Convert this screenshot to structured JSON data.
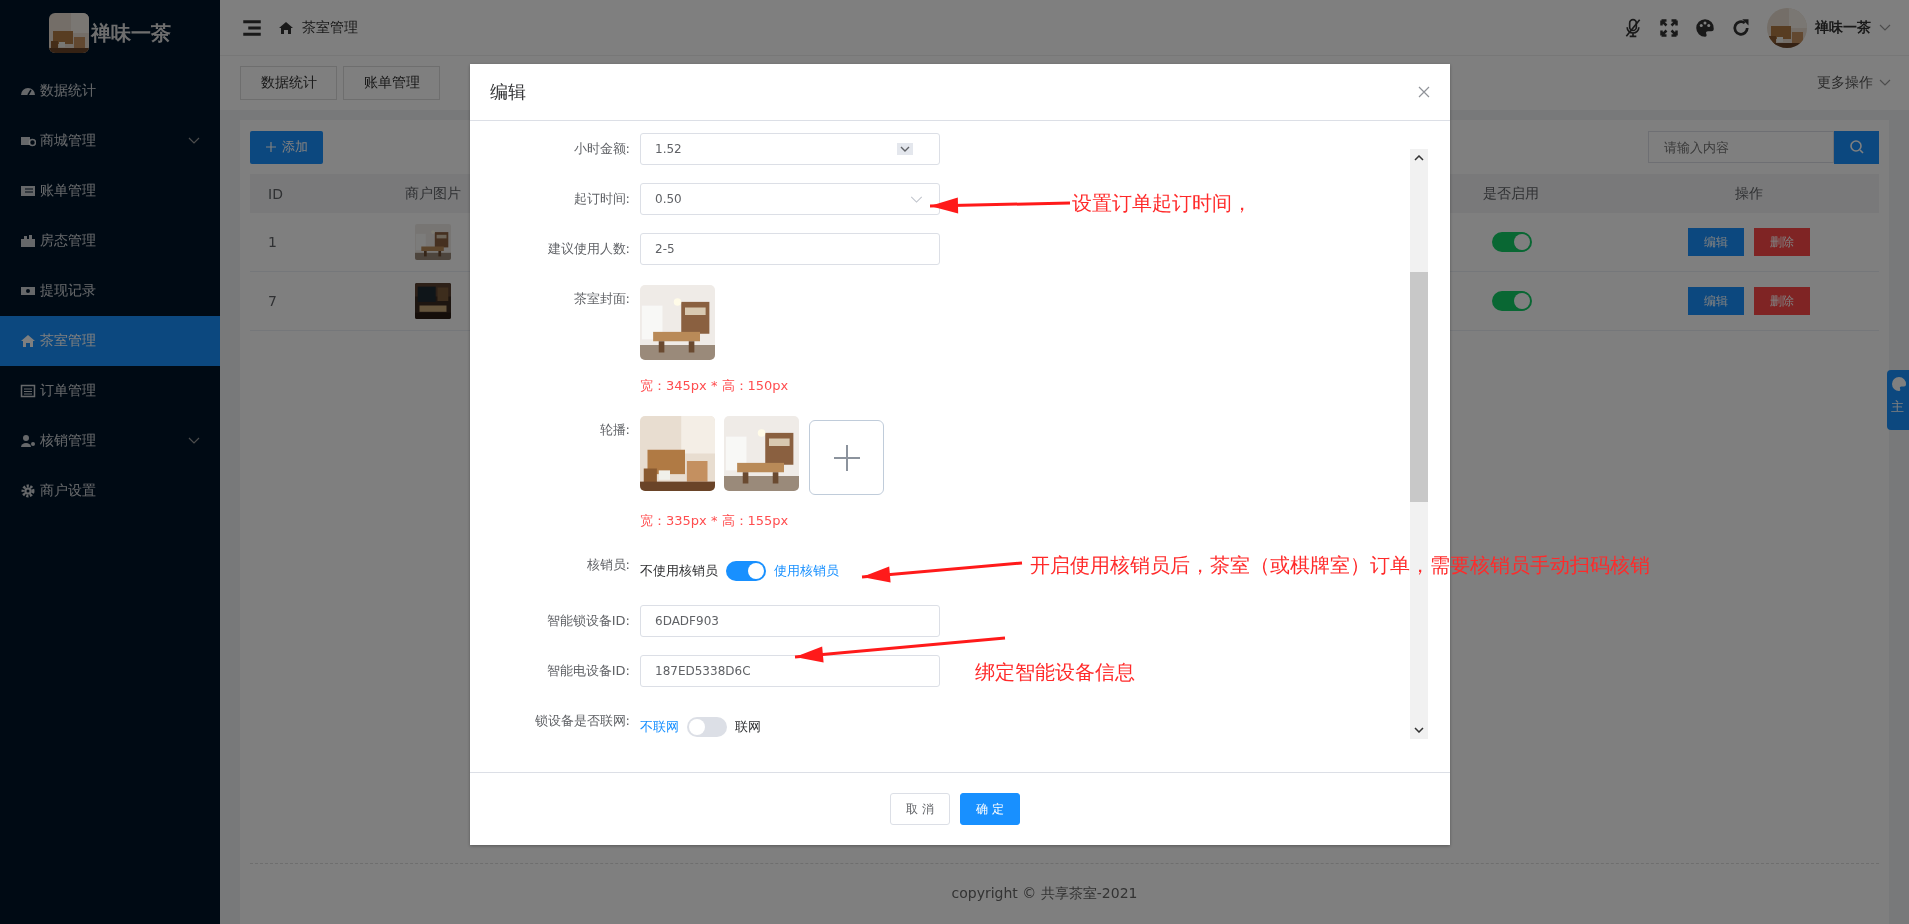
{
  "sidebar": {
    "logo_text": "禅味一茶",
    "items": [
      {
        "label": "数据统计",
        "selected": false,
        "expandable": false
      },
      {
        "label": "商城管理",
        "selected": false,
        "expandable": true
      },
      {
        "label": "账单管理",
        "selected": false,
        "expandable": false
      },
      {
        "label": "房态管理",
        "selected": false,
        "expandable": false
      },
      {
        "label": "提现记录",
        "selected": false,
        "expandable": false
      },
      {
        "label": "茶室管理",
        "selected": true,
        "expandable": false
      },
      {
        "label": "订单管理",
        "selected": false,
        "expandable": false
      },
      {
        "label": "核销管理",
        "selected": false,
        "expandable": true
      },
      {
        "label": "商户设置",
        "selected": false,
        "expandable": false
      }
    ]
  },
  "header": {
    "breadcrumb": "茶室管理",
    "user_name": "禅味一茶"
  },
  "tabs": [
    {
      "label": "数据统计"
    },
    {
      "label": "账单管理"
    }
  ],
  "more_actions": "更多操作",
  "toolbar": {
    "add_label": "添加",
    "search": {
      "placeholder": "请输入内容"
    }
  },
  "table": {
    "columns": [
      "ID",
      "商户图片",
      "是否启用",
      "操作"
    ],
    "rows": [
      {
        "id": "1",
        "enabled": true,
        "actions": [
          "编辑",
          "删除"
        ]
      },
      {
        "id": "7",
        "enabled": true,
        "actions": [
          "编辑",
          "删除"
        ]
      }
    ]
  },
  "theme_tab": "主",
  "footer": "copyright © 共享茶室-2021",
  "modal": {
    "title": "编辑",
    "fields": [
      {
        "kind": "number",
        "label": "小时金额:",
        "value": "1.52"
      },
      {
        "kind": "select",
        "label": "起订时间:",
        "value": "0.50"
      },
      {
        "kind": "text",
        "label": "建议使用人数:",
        "value": "2-5"
      },
      {
        "label": "茶室封面:",
        "hint": "宽：345px * 高：150px"
      },
      {
        "kind": "gallery",
        "label": "轮播:",
        "hint": "宽：335px * 高：155px"
      },
      {
        "kind": "switch",
        "label": "核销员:",
        "off_label": "不使用核销员",
        "on_label": "使用核销员",
        "on": true
      },
      {
        "kind": "text",
        "label": "智能锁设备ID:",
        "value": "6DADF903"
      },
      {
        "kind": "text",
        "label": "智能电设备ID:",
        "value": "187ED5338D6C"
      },
      {
        "kind": "switch",
        "label": "锁设备是否联网:",
        "off_label": "不联网",
        "on_label": "联网",
        "on": false
      }
    ],
    "buttons": [
      {
        "label": "取 消",
        "kind": "cancel"
      },
      {
        "label": "确 定",
        "kind": "primary"
      }
    ]
  },
  "annotations": [
    {
      "text": "设置订单起订时间，"
    },
    {
      "text": "开启使用核销员后，茶室（或棋牌室）订单，需要核销员手动扫码核销"
    },
    {
      "text": "绑定智能设备信息"
    }
  ]
}
